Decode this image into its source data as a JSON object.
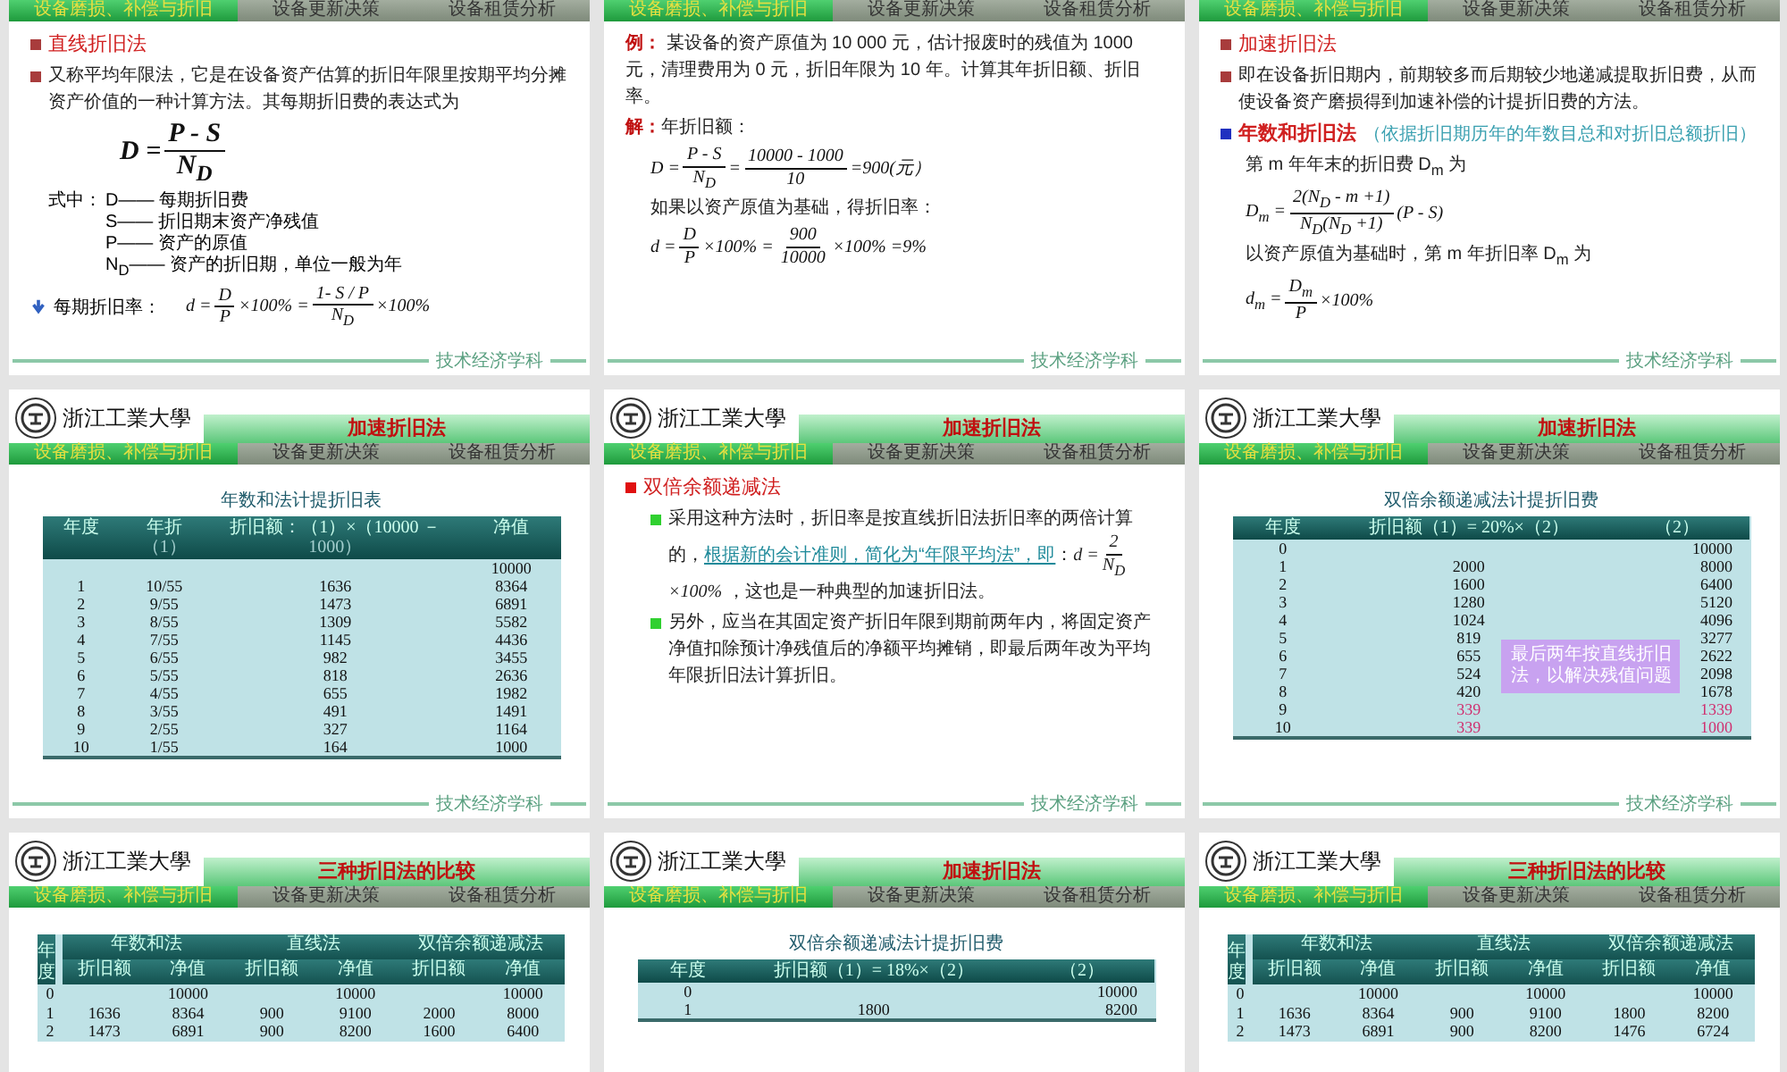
{
  "slides": [
    {
      "tabs": [
        {
          "label": "设备磨损、补偿与折旧",
          "selected": true
        },
        {
          "label": "设备更新决策",
          "selected": false
        },
        {
          "label": "设备租赁分析",
          "selected": false
        }
      ],
      "footer": "技术经济学科",
      "blocks": [
        {
          "kind": "heading",
          "color": "#a83c3c",
          "bold": false,
          "text": "直线折旧法"
        },
        {
          "kind": "para",
          "color": "#a83c3c",
          "text": "又称平均年限法，它是在设备资产估算的折旧年限里按期平均分摊资产价值的一种计算方法。其每期折旧费的表达式为"
        },
        {
          "kind": "formula",
          "large": true,
          "parts": [
            {
              "t": "D ="
            },
            {
              "num": "P - S",
              "den": "N$_{D}$"
            }
          ]
        },
        {
          "kind": "legend",
          "label": "式中：",
          "lines": [
            "D—— 每期折旧费",
            "S—— 折旧期末资产净残值",
            "P—— 资产的原值",
            "N$_{D}$—— 资产的折旧期，单位一般为年"
          ]
        },
        {
          "kind": "formula",
          "label": "每期折旧率：",
          "parts": [
            {
              "t": "d ="
            },
            {
              "num": "D",
              "den": "P"
            },
            {
              "t": "×100% ="
            },
            {
              "num": "1- S / P",
              "den": "N$_{D}$"
            },
            {
              "t": "×100%"
            }
          ]
        }
      ]
    },
    {
      "tabs": [
        {
          "label": "设备磨损、补偿与折旧",
          "selected": true
        },
        {
          "label": "设备更新决策",
          "selected": false
        },
        {
          "label": "设备租赁分析",
          "selected": false
        }
      ],
      "footer": "技术经济学科",
      "blocks": [
        {
          "kind": "para",
          "text": "**例：** 某设备的资产原值为 10 000 元，估计报废时的残值为 1000 元，清理费用为 0 元，折旧年限为 10 年。计算其年折旧额、折旧率。"
        },
        {
          "kind": "para",
          "text": "**解：**年折旧额：",
          "children": [
            {
              "kind": "formula",
              "parts": [
                {
                  "t": "D ="
                },
                {
                  "num": "P - S",
                  "den": "N$_{D}$"
                },
                {
                  "t": "="
                },
                {
                  "num": "10000 - 1000",
                  "den": "10"
                },
                {
                  "t": "=900(元）"
                }
              ]
            },
            {
              "kind": "para",
              "text": "如果以资产原值为基础，得折旧率："
            },
            {
              "kind": "formula",
              "parts": [
                {
                  "t": "d ="
                },
                {
                  "num": "D",
                  "den": "P"
                },
                {
                  "t": "×100% ="
                },
                {
                  "num": "900",
                  "den": "10000"
                },
                {
                  "t": "×100% =9%"
                }
              ]
            }
          ]
        }
      ]
    },
    {
      "tabs": [
        {
          "label": "设备磨损、补偿与折旧",
          "selected": true
        },
        {
          "label": "设备更新决策",
          "selected": false
        },
        {
          "label": "设备租赁分析",
          "selected": false
        }
      ],
      "footer": "技术经济学科",
      "blocks": [
        {
          "kind": "heading",
          "color": "#a83c3c",
          "bold": false,
          "text": "加速折旧法"
        },
        {
          "kind": "para",
          "color": "#a83c3c",
          "text": "即在设备折旧期内，前期较多而后期较少地递减提取折旧费，从而使设备资产磨损得到加速补偿的计提折旧费的方法。"
        },
        {
          "kind": "heading",
          "color": "#2030c0",
          "bold": true,
          "text": "年数和折旧法",
          "note": "（依据折旧期历年的年数目总和对折旧总额折旧）",
          "children": [
            {
              "kind": "para",
              "text": "第 m 年年末的折旧费 D$_{m}$ 为"
            },
            {
              "kind": "formula",
              "parts": [
                {
                  "t": "D$_{m}$ ="
                },
                {
                  "num": "2(N$_{D}$ - m +1)",
                  "den": "N$_{D}$(N$_{D}$ +1)"
                },
                {
                  "t": "(P - S)"
                }
              ]
            },
            {
              "kind": "para",
              "text": "以资产原值为基础时，第 m 年折旧率 D$_{m}$ 为"
            },
            {
              "kind": "formula",
              "parts": [
                {
                  "t": "d$_{m}$ ="
                },
                {
                  "num": "D$_{m}$",
                  "den": "P"
                },
                {
                  "t": "×100%"
                }
              ]
            }
          ]
        }
      ]
    },
    {
      "header": {
        "logo": "浙江工業大學",
        "title": "加速折旧法"
      },
      "tabs": [
        {
          "label": "设备磨损、补偿与折旧",
          "selected": true
        },
        {
          "label": "设备更新决策",
          "selected": false
        },
        {
          "label": "设备租赁分析",
          "selected": false
        }
      ],
      "footer": "技术经济学科",
      "blocks": [
        {
          "kind": "table",
          "title": "年数和法计提折旧表",
          "columns": [
            {
              "label": "年度"
            },
            {
              "label": "年折",
              "sub": "（1）"
            },
            {
              "label": "折旧额：（1）×（10000 －",
              "sub": "1000）"
            },
            {
              "label": "净值"
            }
          ],
          "rows": [
            {
              "cells": [
                "",
                "",
                "",
                "10000"
              ],
              "highlighted": false
            },
            {
              "cells": [
                "1",
                "10/55",
                "1636",
                "8364"
              ],
              "highlighted": false
            },
            {
              "cells": [
                "2",
                "9/55",
                "1473",
                "6891"
              ],
              "highlighted": false
            },
            {
              "cells": [
                "3",
                "8/55",
                "1309",
                "5582"
              ],
              "highlighted": false
            },
            {
              "cells": [
                "4",
                "7/55",
                "1145",
                "4436"
              ],
              "highlighted": false
            },
            {
              "cells": [
                "5",
                "6/55",
                "982",
                "3455"
              ],
              "highlighted": false
            },
            {
              "cells": [
                "6",
                "5/55",
                "818",
                "2636"
              ],
              "highlighted": false
            },
            {
              "cells": [
                "7",
                "4/55",
                "655",
                "1982"
              ],
              "highlighted": false
            },
            {
              "cells": [
                "8",
                "3/55",
                "491",
                "1491"
              ],
              "highlighted": false
            },
            {
              "cells": [
                "9",
                "2/55",
                "327",
                "1164"
              ],
              "highlighted": false
            },
            {
              "cells": [
                "10",
                "1/55",
                "164",
                "1000"
              ],
              "highlighted": false
            }
          ]
        }
      ]
    },
    {
      "header": {
        "logo": "浙江工業大學",
        "title": "加速折旧法"
      },
      "tabs": [
        {
          "label": "设备磨损、补偿与折旧",
          "selected": true
        },
        {
          "label": "设备更新决策",
          "selected": false
        },
        {
          "label": "设备租赁分析",
          "selected": false
        }
      ],
      "footer": "技术经济学科",
      "blocks": [
        {
          "kind": "heading",
          "color": "#e01010",
          "bold": false,
          "text": "双倍余额递减法",
          "children": [
            {
              "kind": "para",
              "color": "#30d030",
              "parts": [
                {
                  "t": "采用这种方法时，折旧率是按直线折旧法折旧率的两倍计算的，"
                },
                {
                  "t": "根据新的会计准则，简化为“年限平均法”，即",
                  "emphasis": true
                },
                {
                  "t": "："
                },
                {
                  "t": "d =",
                  "math": true
                },
                {
                  "num": "2",
                  "den": "N$_{D}$"
                },
                {
                  "t": "×100%",
                  "math": true
                },
                {
                  "t": " ，这也是一种典型的加速折旧法。"
                }
              ]
            },
            {
              "kind": "para",
              "color": "#30d030",
              "text": "另外，应当在其固定资产折旧年限到期前两年内，将固定资产净值扣除预计净残值后的净额平均摊销，即最后两年改为平均年限折旧法计算折旧。"
            }
          ]
        }
      ]
    },
    {
      "header": {
        "logo": "浙江工業大學",
        "title": "加速折旧法"
      },
      "tabs": [
        {
          "label": "设备磨损、补偿与折旧",
          "selected": true
        },
        {
          "label": "设备更新决策",
          "selected": false
        },
        {
          "label": "设备租赁分析",
          "selected": false
        }
      ],
      "footer": "技术经济学科",
      "blocks": [
        {
          "kind": "table",
          "title": "双倍余额递减法计提折旧费",
          "callout": "最后两年按直线折旧法，以解决残值问题",
          "columns": [
            {
              "label": "年度"
            },
            {
              "label": "折旧额（1）= 20%×（2）"
            },
            {
              "label": "（2）"
            }
          ],
          "rows": [
            {
              "cells": [
                "0",
                "",
                "10000"
              ],
              "highlighted": false
            },
            {
              "cells": [
                "1",
                "2000",
                "8000"
              ],
              "highlighted": false
            },
            {
              "cells": [
                "2",
                "1600",
                "6400"
              ],
              "highlighted": false
            },
            {
              "cells": [
                "3",
                "1280",
                "5120"
              ],
              "highlighted": false
            },
            {
              "cells": [
                "4",
                "1024",
                "4096"
              ],
              "highlighted": false
            },
            {
              "cells": [
                "5",
                "819",
                "3277"
              ],
              "highlighted": false
            },
            {
              "cells": [
                "6",
                "655",
                "2622"
              ],
              "highlighted": false
            },
            {
              "cells": [
                "7",
                "524",
                "2098"
              ],
              "highlighted": false
            },
            {
              "cells": [
                "8",
                "420",
                "1678"
              ],
              "highlighted": false
            },
            {
              "cells": [
                "9",
                "339",
                "1339"
              ],
              "highlighted": true
            },
            {
              "cells": [
                "10",
                "339",
                "1000"
              ],
              "highlighted": true
            }
          ]
        }
      ]
    },
    {
      "header": {
        "logo": "浙江工業大學",
        "title": "三种折旧法的比较"
      },
      "tabs": [
        {
          "label": "设备磨损、补偿与折旧",
          "selected": true
        },
        {
          "label": "设备更新决策",
          "selected": false
        },
        {
          "label": "设备租赁分析",
          "selected": false
        }
      ],
      "blocks": [
        {
          "kind": "compare",
          "year_label": "年度",
          "groups": [
            "年数和法",
            "直线法",
            "双倍余额递减法"
          ],
          "sub_columns": [
            "折旧额",
            "净值",
            "折旧额",
            "净值",
            "折旧额",
            "净值"
          ],
          "rows": [
            [
              "0",
              "",
              "10000",
              "",
              "10000",
              "",
              "10000"
            ],
            [
              "1",
              "1636",
              "8364",
              "900",
              "9100",
              "2000",
              "8000"
            ],
            [
              "2",
              "1473",
              "6891",
              "900",
              "8200",
              "1600",
              "6400"
            ]
          ]
        }
      ]
    },
    {
      "header": {
        "logo": "浙江工業大學",
        "title": "加速折旧法"
      },
      "tabs": [
        {
          "label": "设备磨损、补偿与折旧",
          "selected": true
        },
        {
          "label": "设备更新决策",
          "selected": false
        },
        {
          "label": "设备租赁分析",
          "selected": false
        }
      ],
      "blocks": [
        {
          "kind": "table",
          "title": "双倍余额递减法计提折旧费",
          "columns": [
            {
              "label": "年度"
            },
            {
              "label": "折旧额（1）= 18%×（2）"
            },
            {
              "label": "（2）"
            }
          ],
          "rows": [
            {
              "cells": [
                "0",
                "",
                "10000"
              ],
              "highlighted": false
            },
            {
              "cells": [
                "1",
                "1800",
                "8200"
              ],
              "highlighted": false
            }
          ]
        }
      ]
    },
    {
      "header": {
        "logo": "浙江工業大學",
        "title": "三种折旧法的比较"
      },
      "tabs": [
        {
          "label": "设备磨损、补偿与折旧",
          "selected": true
        },
        {
          "label": "设备更新决策",
          "selected": false
        },
        {
          "label": "设备租赁分析",
          "selected": false
        }
      ],
      "blocks": [
        {
          "kind": "compare",
          "year_label": "年度",
          "groups": [
            "年数和法",
            "直线法",
            "双倍余额递减法"
          ],
          "sub_columns": [
            "折旧额",
            "净值",
            "折旧额",
            "净值",
            "折旧额",
            "净值"
          ],
          "rows": [
            [
              "0",
              "",
              "10000",
              "",
              "10000",
              "",
              "10000"
            ],
            [
              "1",
              "1636",
              "8364",
              "900",
              "9100",
              "1800",
              "8200"
            ],
            [
              "2",
              "1473",
              "6891",
              "900",
              "8200",
              "1476",
              "6724"
            ]
          ]
        }
      ]
    }
  ]
}
